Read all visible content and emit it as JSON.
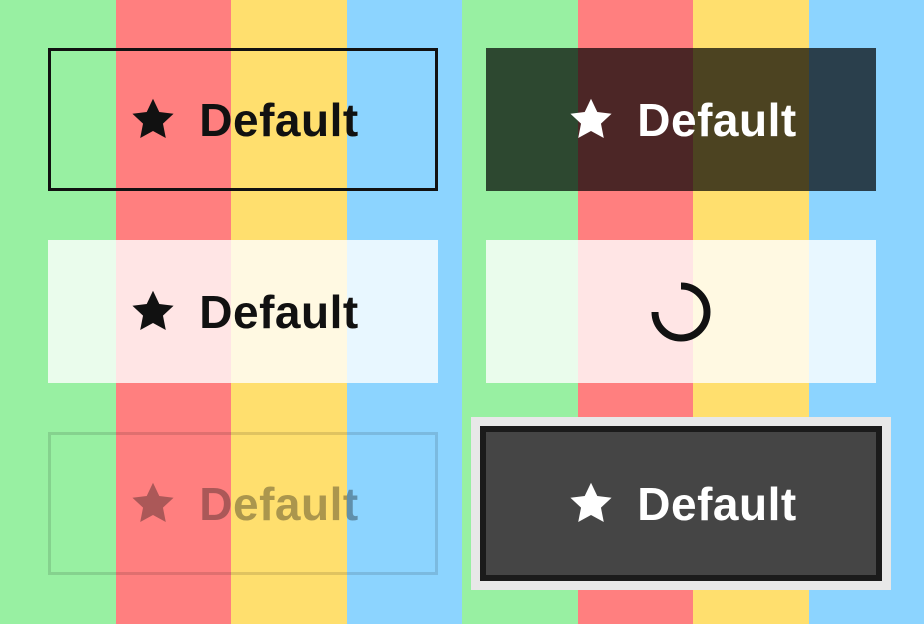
{
  "background": {
    "stripes": [
      {
        "name": "green",
        "color": "#98F0A2"
      },
      {
        "name": "red",
        "color": "#FF7F7F"
      },
      {
        "name": "yellow",
        "color": "#FFDF6E"
      },
      {
        "name": "blue",
        "color": "#8CD4FF"
      },
      {
        "name": "green",
        "color": "#98F0A2"
      },
      {
        "name": "red",
        "color": "#FF7F7F"
      },
      {
        "name": "yellow",
        "color": "#FFDF6E"
      },
      {
        "name": "blue",
        "color": "#8CD4FF"
      }
    ]
  },
  "buttons": {
    "outline": {
      "label": "Default",
      "icon": "star-icon",
      "state": "default"
    },
    "filled": {
      "label": "Default",
      "icon": "star-icon",
      "state": "default"
    },
    "light": {
      "label": "Default",
      "icon": "star-icon",
      "state": "default"
    },
    "loading": {
      "icon": "spinner-icon",
      "state": "loading"
    },
    "disabled": {
      "label": "Default",
      "icon": "star-icon",
      "state": "disabled"
    },
    "focused": {
      "label": "Default",
      "icon": "star-icon",
      "state": "focused"
    }
  }
}
